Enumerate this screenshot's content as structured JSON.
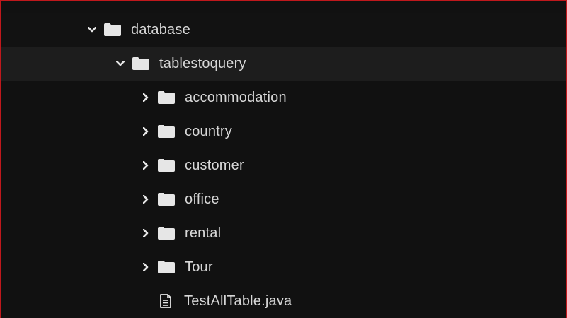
{
  "tree": {
    "items": [
      {
        "label": "database",
        "type": "folder",
        "expanded": true,
        "icon": "folder-icon",
        "chevron": "chevron-down-icon"
      },
      {
        "label": "tablestoquery",
        "type": "folder",
        "expanded": true,
        "icon": "folder-icon",
        "chevron": "chevron-down-icon"
      },
      {
        "label": "accommodation",
        "type": "folder",
        "expanded": false,
        "icon": "folder-icon",
        "chevron": "chevron-right-icon"
      },
      {
        "label": "country",
        "type": "folder",
        "expanded": false,
        "icon": "folder-icon",
        "chevron": "chevron-right-icon"
      },
      {
        "label": "customer",
        "type": "folder",
        "expanded": false,
        "icon": "folder-icon",
        "chevron": "chevron-right-icon"
      },
      {
        "label": "office",
        "type": "folder",
        "expanded": false,
        "icon": "folder-icon",
        "chevron": "chevron-right-icon"
      },
      {
        "label": "rental",
        "type": "folder",
        "expanded": false,
        "icon": "folder-icon",
        "chevron": "chevron-right-icon"
      },
      {
        "label": "Tour",
        "type": "folder",
        "expanded": false,
        "icon": "folder-icon",
        "chevron": "chevron-right-icon"
      },
      {
        "label": "TestAllTable.java",
        "type": "file",
        "icon": "file-icon"
      }
    ]
  },
  "colors": {
    "background": "#111111",
    "selected_row": "#1d1d1d",
    "text": "#d7d7d7",
    "icon": "#e6e6e6",
    "frame_border": "#c0181c"
  }
}
